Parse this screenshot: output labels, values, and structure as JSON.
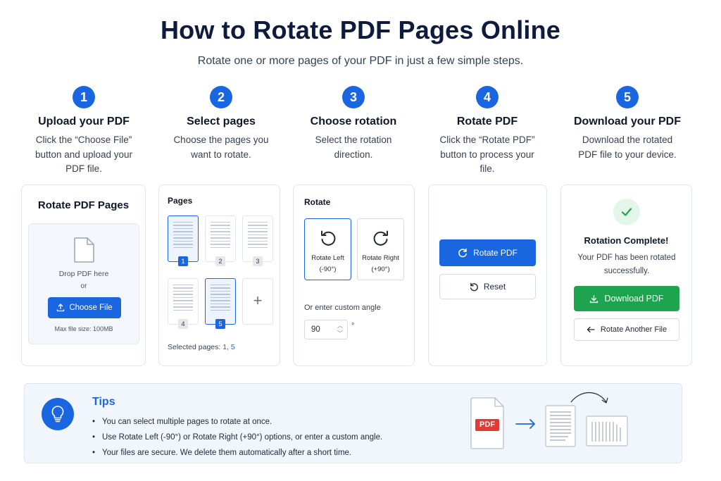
{
  "header": {
    "title": "How to Rotate PDF Pages Online",
    "subtitle": "Rotate one or more pages of your PDF in just a few simple steps."
  },
  "steps": [
    {
      "number": "1",
      "title": "Upload your PDF",
      "desc": "Click the “Choose File” button and upload your PDF file."
    },
    {
      "number": "2",
      "title": "Select pages",
      "desc": "Choose the pages you want to rotate."
    },
    {
      "number": "3",
      "title": "Choose rotation",
      "desc": "Select the rotation direction."
    },
    {
      "number": "4",
      "title": "Rotate PDF",
      "desc": "Click the “Rotate PDF” button to process your file."
    },
    {
      "number": "5",
      "title": "Download your PDF",
      "desc": "Download the rotated PDF file to your device."
    }
  ],
  "upload_card": {
    "title": "Rotate PDF Pages",
    "drop_text": "Drop PDF here",
    "or_text": "or",
    "button_label": "Choose File",
    "max_size": "Max file size: 100MB"
  },
  "pages_card": {
    "title": "Pages",
    "pages": [
      {
        "label": "1",
        "selected": true
      },
      {
        "label": "2",
        "selected": false
      },
      {
        "label": "3",
        "selected": false
      },
      {
        "label": "4",
        "selected": false
      },
      {
        "label": "5",
        "selected": true
      }
    ],
    "add_label": "+",
    "selected_label": "Selected pages:",
    "selected_value": "1, 5"
  },
  "rotate_card": {
    "title": "Rotate",
    "left_label_line1": "Rotate Left",
    "left_label_line2": "(-90°)",
    "right_label_line1": "Rotate Right",
    "right_label_line2": "(+90°)",
    "custom_label": "Or enter custom angle",
    "angle_value": "90",
    "degree_symbol": "°"
  },
  "action_card": {
    "rotate_label": "Rotate PDF",
    "reset_label": "Reset"
  },
  "download_card": {
    "title": "Rotation Complete!",
    "desc": "Your PDF has been rotated successfully.",
    "download_label": "Download PDF",
    "another_label": "Rotate Another File"
  },
  "tips": {
    "title": "Tips",
    "items": [
      "You can select multiple pages to rotate at once.",
      "Use Rotate Left (-90°) or Rotate Right (+90°) options, or enter a custom angle.",
      "Your files are secure. We delete them automatically after a short time."
    ],
    "pdf_badge": "PDF"
  },
  "colors": {
    "primary": "#1a66e0",
    "success": "#1ea34f",
    "pdf_red": "#e53935"
  }
}
